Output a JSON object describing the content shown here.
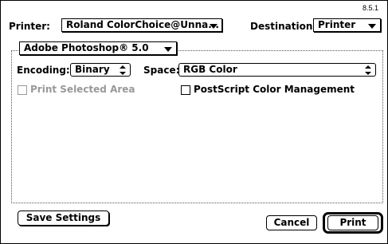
{
  "version": "8.5.1",
  "printer": {
    "label": "Printer:",
    "value": "Roland ColorChoice@Unna..."
  },
  "destination": {
    "label": "Destination:",
    "value": "Printer"
  },
  "panel": {
    "value": "Adobe Photoshop® 5.0"
  },
  "encoding": {
    "label": "Encoding:",
    "value": "Binary"
  },
  "space": {
    "label": "Space:",
    "value": "RGB Color"
  },
  "options": {
    "print_selected_area": {
      "label": "Print Selected Area",
      "checked": false,
      "enabled": false
    },
    "postscript_color_mgmt": {
      "label": "PostScript Color Management",
      "checked": false,
      "enabled": true
    }
  },
  "buttons": {
    "save_settings": "Save Settings",
    "cancel": "Cancel",
    "print": "Print"
  }
}
